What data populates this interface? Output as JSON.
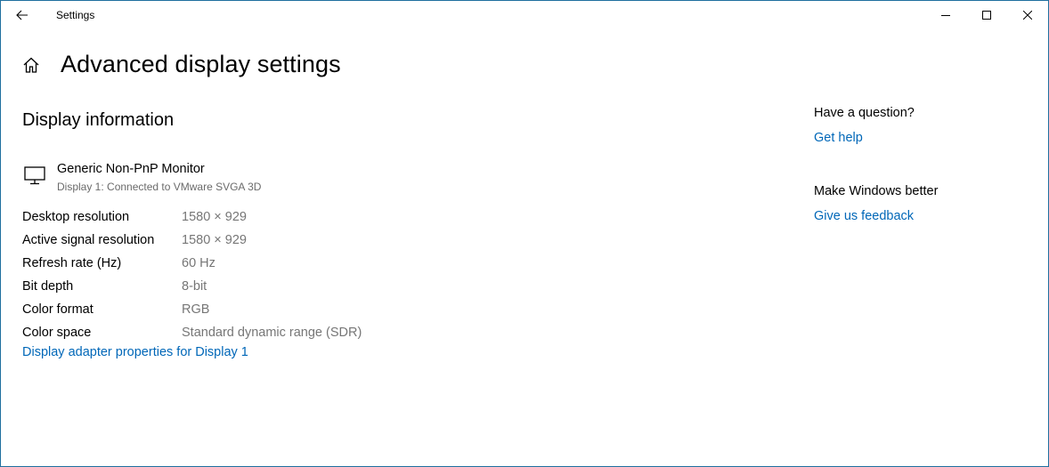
{
  "window": {
    "title": "Settings"
  },
  "page": {
    "title": "Advanced display settings"
  },
  "section": {
    "title": "Display information"
  },
  "monitor": {
    "name": "Generic Non-PnP Monitor",
    "subtitle": "Display 1: Connected to VMware SVGA 3D",
    "icon": "monitor-icon"
  },
  "info": [
    {
      "label": "Desktop resolution",
      "value": "1580 × 929"
    },
    {
      "label": "Active signal resolution",
      "value": "1580 × 929"
    },
    {
      "label": "Refresh rate (Hz)",
      "value": "60 Hz"
    },
    {
      "label": "Bit depth",
      "value": "8-bit"
    },
    {
      "label": "Color format",
      "value": "RGB"
    },
    {
      "label": "Color space",
      "value": "Standard dynamic range (SDR)"
    }
  ],
  "adapter_link": "Display adapter properties for Display 1",
  "side": {
    "question_heading": "Have a question?",
    "get_help": "Get help",
    "better_heading": "Make Windows better",
    "feedback": "Give us feedback"
  },
  "colors": {
    "accent": "#0067b8",
    "border": "#1f6f9f",
    "secondary_text": "#767676"
  }
}
